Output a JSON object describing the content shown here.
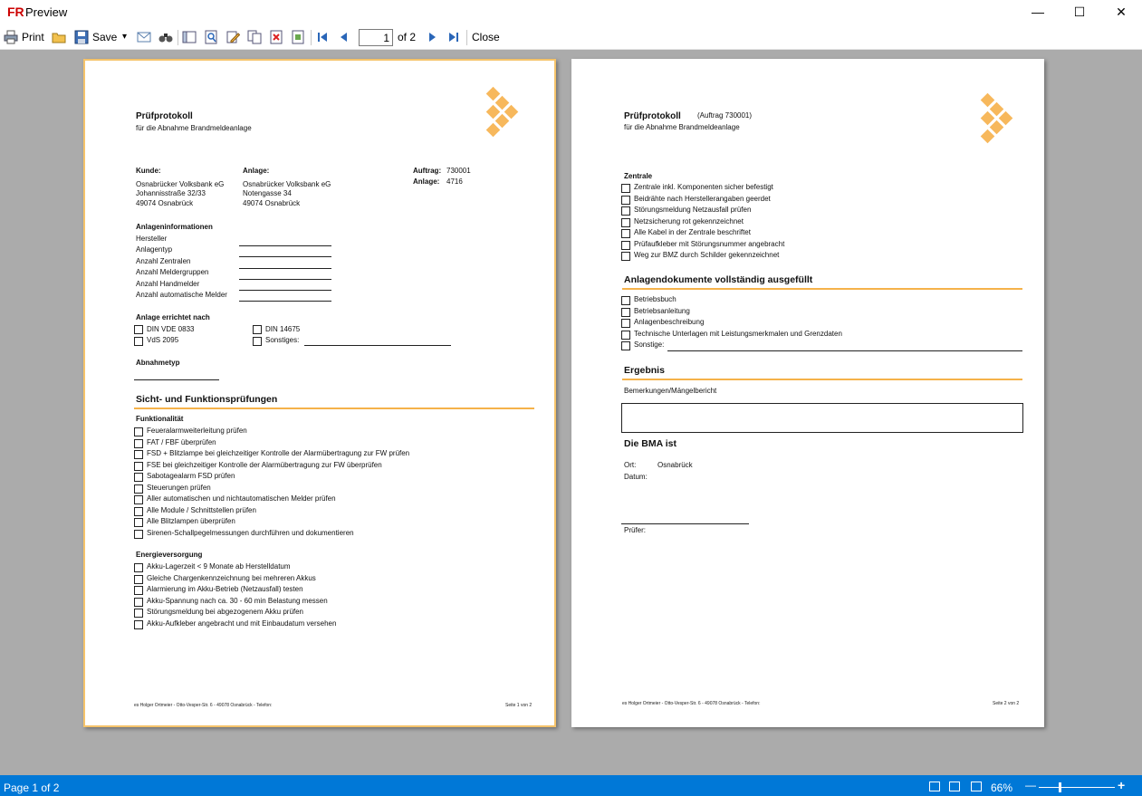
{
  "window": {
    "title": "Preview",
    "logo": "FR",
    "minimize_icon": "—",
    "maximize_icon": "☐",
    "close_icon": "✕"
  },
  "toolbar": {
    "print_label": "Print",
    "save_label": "Save",
    "save_dropdown_icon": "▾",
    "page_value": "1",
    "page_of": "of 2",
    "close_label": "Close",
    "icons": [
      "printer-icon",
      "open-icon",
      "save-icon",
      "email-icon",
      "find-icon",
      "outline-icon",
      "zoom-icon",
      "edit-icon",
      "copy-page-icon",
      "delete-page-icon",
      "watermark-icon",
      "first-page-icon",
      "prev-page-icon",
      "next-page-icon",
      "last-page-icon"
    ]
  },
  "page1": {
    "title": "Prüfprotokoll",
    "subtitle": "für die Abnahme Brandmeldeanlage",
    "kunde_label": "Kunde:",
    "kunde_lines": [
      "Osnabrücker Volksbank eG",
      "Johannisstraße 32/33",
      "49074 Osnabrück"
    ],
    "anlage_label": "Anlage:",
    "anlage_lines": [
      "Osnabrücker Volksbank eG",
      "Notengasse 34",
      "49074 Osnabrück"
    ],
    "auftrag_label": "Auftrag:",
    "auftrag_value": "730001",
    "anlage_nr_label": "Anlage:",
    "anlage_nr_value": "4716",
    "info_heading": "Anlageninformationen",
    "info_items": [
      "Hersteller",
      "Anlagentyp",
      "Anzahl Zentralen",
      "Anzahl Meldergruppen",
      "Anzahl Handmelder",
      "Anzahl automatische Melder"
    ],
    "errichtet_heading": "Anlage errichtet nach",
    "norm_items": [
      "DIN VDE 0833",
      "VdS 2095",
      "DIN 14675",
      "Sonstiges:"
    ],
    "abnahmetyp_label": "Abnahmetyp",
    "section_heading": "Sicht- und Funktionsprüfungen",
    "funktion_heading": "Funktionalität",
    "funktion_items": [
      "Feueralarmweiterleitung prüfen",
      "FAT / FBF überprüfen",
      "FSD + Blitzlampe bei gleichzeitiger Kontrolle der Alarmübertragung zur FW prüfen",
      "FSE bei gleichzeitiger Kontrolle der Alarmübertragung zur FW überprüfen",
      "Sabotagealarm FSD prüfen",
      "Steuerungen prüfen",
      "Aller automatischen und nichtautomatischen Melder prüfen",
      "Alle Module / Schnittstellen prüfen",
      "Alle Blitzlampen überprüfen",
      "Sirenen-Schallpegelmessungen durchführen und dokumentieren"
    ],
    "energie_heading": "Energieversorgung",
    "energie_items": [
      "Akku-Lagerzeit < 9 Monate ab Herstelldatum",
      "Gleiche Chargenkennzeichnung bei mehreren Akkus",
      "Alarmierung im Akku-Betrieb (Netzausfall) testen",
      "Akku-Spannung nach ca. 30 - 60 min Belastung messen",
      "Störungsmeldung bei abgezogenem Akku prüfen",
      "Akku-Aufkleber angebracht und mit Einbaudatum versehen"
    ],
    "footer_left": "es Holger Ortmeier - Otto-Vesper-Str. 6 - 49078 Osnabrück - Telefon:",
    "footer_right": "Seite 1 von 2"
  },
  "page2": {
    "title": "Prüfprotokoll",
    "auftrag_tag": "(Auftrag 730001)",
    "subtitle": "für die Abnahme Brandmeldeanlage",
    "zentrale_heading": "Zentrale",
    "zentrale_items": [
      "Zentrale inkl. Komponenten sicher befestigt",
      "Beidrähte nach Herstellerangaben geerdet",
      "Störungsmeldung Netzausfall prüfen",
      "Netzsicherung rot gekennzeichnet",
      "Alle Kabel in der Zentrale beschriftet",
      "Prüfaufkleber mit Störungsnummer angebracht",
      "Weg zur BMZ durch Schilder gekennzeichnet"
    ],
    "dokumente_heading": "Anlagendokumente vollständig ausgefüllt",
    "dokumente_items": [
      "Betriebsbuch",
      "Betriebsanleitung",
      "Anlagenbeschreibung",
      "Technische Unterlagen mit Leistungsmerkmalen und Grenzdaten",
      "Sonstige:"
    ],
    "ergebnis_heading": "Ergebnis",
    "bemerkungen_label": "Bemerkungen/Mängelbericht",
    "bma_heading": "Die BMA ist",
    "ort_label": "Ort:",
    "ort_value": "Osnabrück",
    "datum_label": "Datum:",
    "pruefer_label": "Prüfer:",
    "footer_left": "es Holger Ortmeier - Otto-Vesper-Str. 6 - 49078 Osnabrück - Telefon:",
    "footer_right": "Seite 2 von 2"
  },
  "statusbar": {
    "page_label": "Page 1 of 2",
    "zoom_label": "66%",
    "zoom_out": "—",
    "zoom_in": "+"
  }
}
